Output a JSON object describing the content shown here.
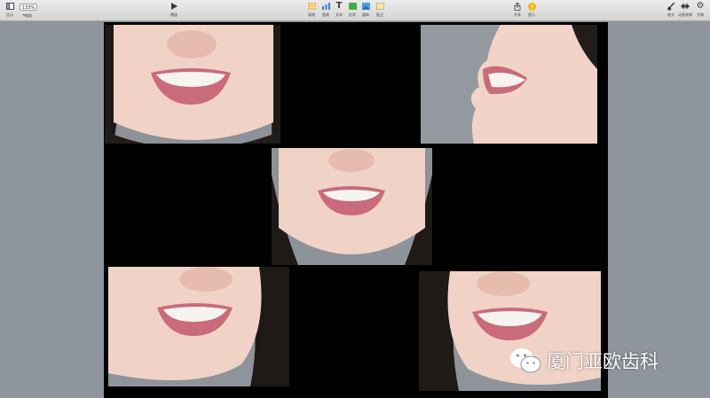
{
  "toolbar": {
    "view_label": "显示",
    "zoom_value": "133%",
    "zoom_label": "缩放",
    "play_label": "播放",
    "table_label": "表格",
    "chart_label": "图表",
    "text_label": "文本",
    "shape_label": "形状",
    "media_label": "媒体",
    "comment_label": "批注",
    "share_label": "共享",
    "tips_label": "提示",
    "format_label": "格式",
    "animate_label": "动画效果",
    "document_label": "文稿"
  },
  "icons": {
    "view": "sidebar-icon",
    "play": "play-icon",
    "table": "table-icon",
    "chart": "chart-icon",
    "text": "text-icon",
    "shape": "shape-icon",
    "media": "media-icon",
    "comment": "comment-icon",
    "share": "share-icon",
    "tips": "help-icon",
    "format": "brush-icon",
    "animate": "animate-icon",
    "document": "gear-icon"
  },
  "colors": {
    "canvas": "#000000",
    "workspace": "#8e959d",
    "table_icon": "#e8b84a",
    "chart_icon": "#3d7fd6",
    "shape_icon": "#3fae49",
    "media_icon": "#4aa0e0",
    "tips_icon": "#f2b705"
  },
  "slide": {
    "photos": [
      {
        "name": "photo-front-smile-top-left"
      },
      {
        "name": "photo-side-profile-top-right"
      },
      {
        "name": "photo-front-smile-center"
      },
      {
        "name": "photo-oblique-smile-bottom-left"
      },
      {
        "name": "photo-oblique-smile-bottom-right"
      }
    ],
    "watermark_text": "厦门亚欧齿科"
  }
}
